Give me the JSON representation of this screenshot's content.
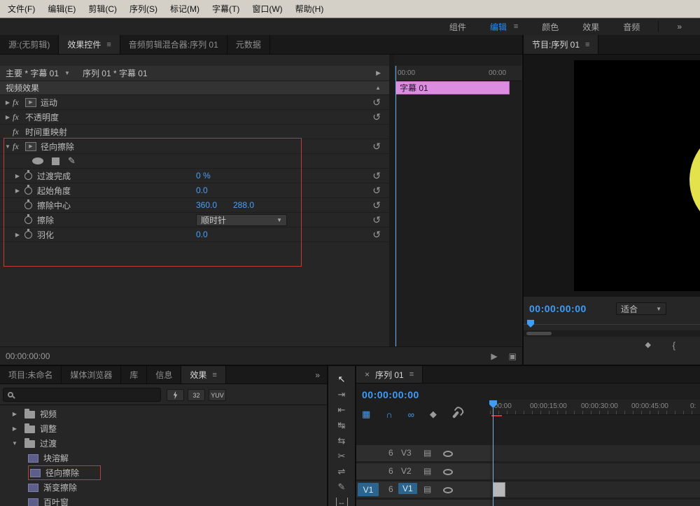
{
  "menubar": {
    "items": [
      "文件(F)",
      "编辑(E)",
      "剪辑(C)",
      "序列(S)",
      "标记(M)",
      "字幕(T)",
      "窗口(W)",
      "帮助(H)"
    ]
  },
  "workspace": {
    "components": "组件",
    "edit": "编辑",
    "color": "颜色",
    "effects": "效果",
    "audio": "音频",
    "overflow": "»"
  },
  "effect_controls": {
    "tabs": {
      "source": "源:(无剪辑)",
      "effect_controls": "效果控件",
      "audio_mixer": "音频剪辑混合器:序列 01",
      "metadata": "元数据"
    },
    "master": "主要 * 字幕 01",
    "sequence": "序列 01 * 字幕 01",
    "section_video_effects": "视频效果",
    "effects": {
      "motion": "运动",
      "opacity": "不透明度",
      "time_remapping": "时间重映射",
      "radial_wipe": "径向擦除"
    },
    "params": {
      "transition_complete": {
        "label": "过渡完成",
        "value": "0 %"
      },
      "start_angle": {
        "label": "起始角度",
        "value": "0.0"
      },
      "wipe_center": {
        "label": "擦除中心",
        "x": "360.0",
        "y": "288.0"
      },
      "wipe": {
        "label": "擦除",
        "value": "顺时针"
      },
      "feather": {
        "label": "羽化",
        "value": "0.0"
      }
    },
    "mini_timeline": {
      "ruler_start": "00:00",
      "ruler_end": "00:00",
      "clip": "字幕 01"
    },
    "status_timecode": "00:00:00:00"
  },
  "program": {
    "title": "节目:序列 01",
    "timecode": "00:00:00:00",
    "fit": "适合"
  },
  "project": {
    "tabs": {
      "project": "项目:未命名",
      "media_browser": "媒体浏览器",
      "libraries": "库",
      "info": "信息",
      "effects": "效果"
    },
    "overflow": "»",
    "badges": {
      "bit32": "32",
      "yuv": "YUV"
    },
    "tree": {
      "video": "视频",
      "adjust": "调整",
      "transition": "过渡",
      "block_dissolve": "块溶解",
      "radial_wipe": "径向擦除",
      "gradient_wipe": "渐变擦除",
      "venetian_blinds": "百叶窗"
    }
  },
  "timeline": {
    "title": "序列 01",
    "timecode": "00:00:00:00",
    "ruler": [
      ":00:00",
      "00:00:15:00",
      "00:00:30:00",
      "00:00:45:00",
      "0:"
    ],
    "tracks": {
      "v3": "V3",
      "v2": "V2",
      "v1": "V1",
      "v1_source": "V1"
    }
  },
  "icons": {
    "menu": "≡",
    "overflow": "»",
    "close": "×",
    "reset": "↺",
    "collapsed": "▶",
    "expanded": "▼",
    "dropdown": "▼",
    "scroll_up": "▲",
    "panel_next": "▶",
    "fx": "fx",
    "pen": "✎",
    "sync_lock": "6",
    "film": "▤",
    "nest": "▦",
    "snap": "∩",
    "link": "∞",
    "marker": "◆",
    "mark_in": "{",
    "play": "▶",
    "export_frame": "▣",
    "selection": "↖",
    "track_select": "⇥",
    "ripple_edit": "⇤",
    "rolling_edit": "↹",
    "rate_stretch": "⇆",
    "razor": "✂",
    "slide": "⇌",
    "zoom": "↔"
  },
  "colors": {
    "accent": "#2d8ceb",
    "value_blue": "#4aa0fa",
    "clip_pink": "#dd8ddf",
    "annotation_red": "#c23b3b",
    "monitor_yellow": "#e3e14c"
  }
}
